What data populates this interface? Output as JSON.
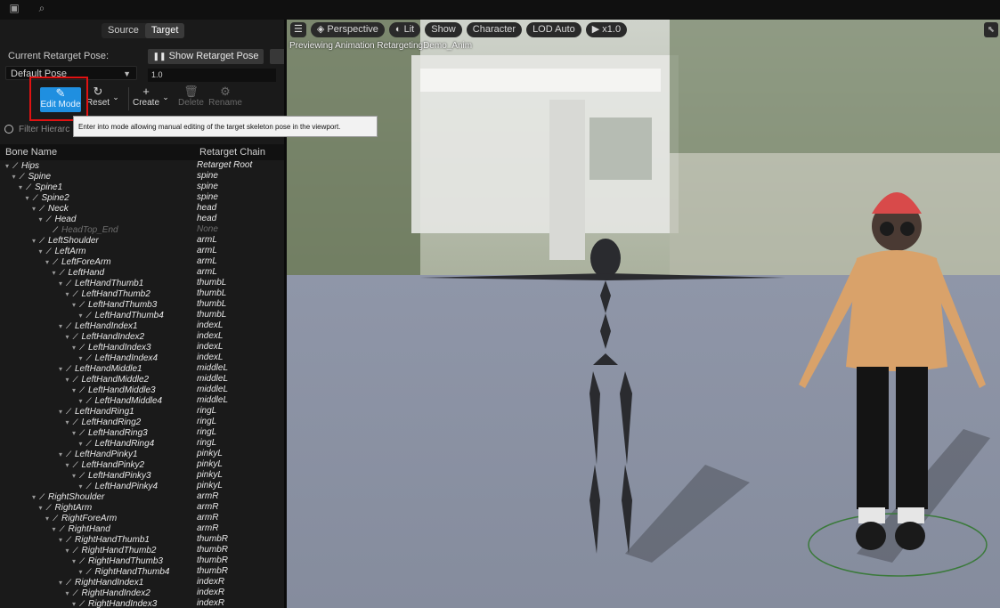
{
  "topbar": {
    "icons": [
      "save-icon",
      "browse-icon"
    ]
  },
  "tabs": {
    "source": "Source",
    "target": "Target"
  },
  "pose": {
    "current_label": "Current Retarget Pose:",
    "current_value": "Default Pose",
    "show_button": "Show Retarget Pose",
    "blend_value": "1.0"
  },
  "toolbar": {
    "edit_mode": "Edit Mode",
    "reset": "Reset",
    "create": "Create",
    "delete": "Delete",
    "rename": "Rename"
  },
  "search": {
    "placeholder": "Filter Hierarc"
  },
  "tooltip": {
    "text": "Enter into mode allowing manual editing of the target skeleton pose in the viewport."
  },
  "columns": {
    "bone": "Bone Name",
    "chain": "Retarget Chain"
  },
  "bones": [
    {
      "name": "Hips",
      "chain": "Retarget Root",
      "depth": 0
    },
    {
      "name": "Spine",
      "chain": "spine",
      "depth": 1
    },
    {
      "name": "Spine1",
      "chain": "spine",
      "depth": 2
    },
    {
      "name": "Spine2",
      "chain": "spine",
      "depth": 3
    },
    {
      "name": "Neck",
      "chain": "head",
      "depth": 4
    },
    {
      "name": "Head",
      "chain": "head",
      "depth": 5
    },
    {
      "name": "HeadTop_End",
      "chain": "None",
      "depth": 6,
      "dim": true
    },
    {
      "name": "LeftShoulder",
      "chain": "armL",
      "depth": 4
    },
    {
      "name": "LeftArm",
      "chain": "armL",
      "depth": 5
    },
    {
      "name": "LeftForeArm",
      "chain": "armL",
      "depth": 6
    },
    {
      "name": "LeftHand",
      "chain": "armL",
      "depth": 7
    },
    {
      "name": "LeftHandThumb1",
      "chain": "thumbL",
      "depth": 8
    },
    {
      "name": "LeftHandThumb2",
      "chain": "thumbL",
      "depth": 9
    },
    {
      "name": "LeftHandThumb3",
      "chain": "thumbL",
      "depth": 10
    },
    {
      "name": "LeftHandThumb4",
      "chain": "thumbL",
      "depth": 11
    },
    {
      "name": "LeftHandIndex1",
      "chain": "indexL",
      "depth": 8
    },
    {
      "name": "LeftHandIndex2",
      "chain": "indexL",
      "depth": 9
    },
    {
      "name": "LeftHandIndex3",
      "chain": "indexL",
      "depth": 10
    },
    {
      "name": "LeftHandIndex4",
      "chain": "indexL",
      "depth": 11
    },
    {
      "name": "LeftHandMiddle1",
      "chain": "middleL",
      "depth": 8
    },
    {
      "name": "LeftHandMiddle2",
      "chain": "middleL",
      "depth": 9
    },
    {
      "name": "LeftHandMiddle3",
      "chain": "middleL",
      "depth": 10
    },
    {
      "name": "LeftHandMiddle4",
      "chain": "middleL",
      "depth": 11
    },
    {
      "name": "LeftHandRing1",
      "chain": "ringL",
      "depth": 8
    },
    {
      "name": "LeftHandRing2",
      "chain": "ringL",
      "depth": 9
    },
    {
      "name": "LeftHandRing3",
      "chain": "ringL",
      "depth": 10
    },
    {
      "name": "LeftHandRing4",
      "chain": "ringL",
      "depth": 11
    },
    {
      "name": "LeftHandPinky1",
      "chain": "pinkyL",
      "depth": 8
    },
    {
      "name": "LeftHandPinky2",
      "chain": "pinkyL",
      "depth": 9
    },
    {
      "name": "LeftHandPinky3",
      "chain": "pinkyL",
      "depth": 10
    },
    {
      "name": "LeftHandPinky4",
      "chain": "pinkyL",
      "depth": 11
    },
    {
      "name": "RightShoulder",
      "chain": "armR",
      "depth": 4
    },
    {
      "name": "RightArm",
      "chain": "armR",
      "depth": 5
    },
    {
      "name": "RightForeArm",
      "chain": "armR",
      "depth": 6
    },
    {
      "name": "RightHand",
      "chain": "armR",
      "depth": 7
    },
    {
      "name": "RightHandThumb1",
      "chain": "thumbR",
      "depth": 8
    },
    {
      "name": "RightHandThumb2",
      "chain": "thumbR",
      "depth": 9
    },
    {
      "name": "RightHandThumb3",
      "chain": "thumbR",
      "depth": 10
    },
    {
      "name": "RightHandThumb4",
      "chain": "thumbR",
      "depth": 11
    },
    {
      "name": "RightHandIndex1",
      "chain": "indexR",
      "depth": 8
    },
    {
      "name": "RightHandIndex2",
      "chain": "indexR",
      "depth": 9
    },
    {
      "name": "RightHandIndex3",
      "chain": "indexR",
      "depth": 10
    }
  ],
  "viewport": {
    "perspective": "Perspective",
    "lit": "Lit",
    "show": "Show",
    "character": "Character",
    "lod": "LOD Auto",
    "speed": "x1.0",
    "caption": "Previewing Animation RetargetingDemo_Anim"
  },
  "colors": {
    "accent": "#1f8fe0",
    "highlight": "#e01212",
    "floor": "#8d94a6"
  }
}
